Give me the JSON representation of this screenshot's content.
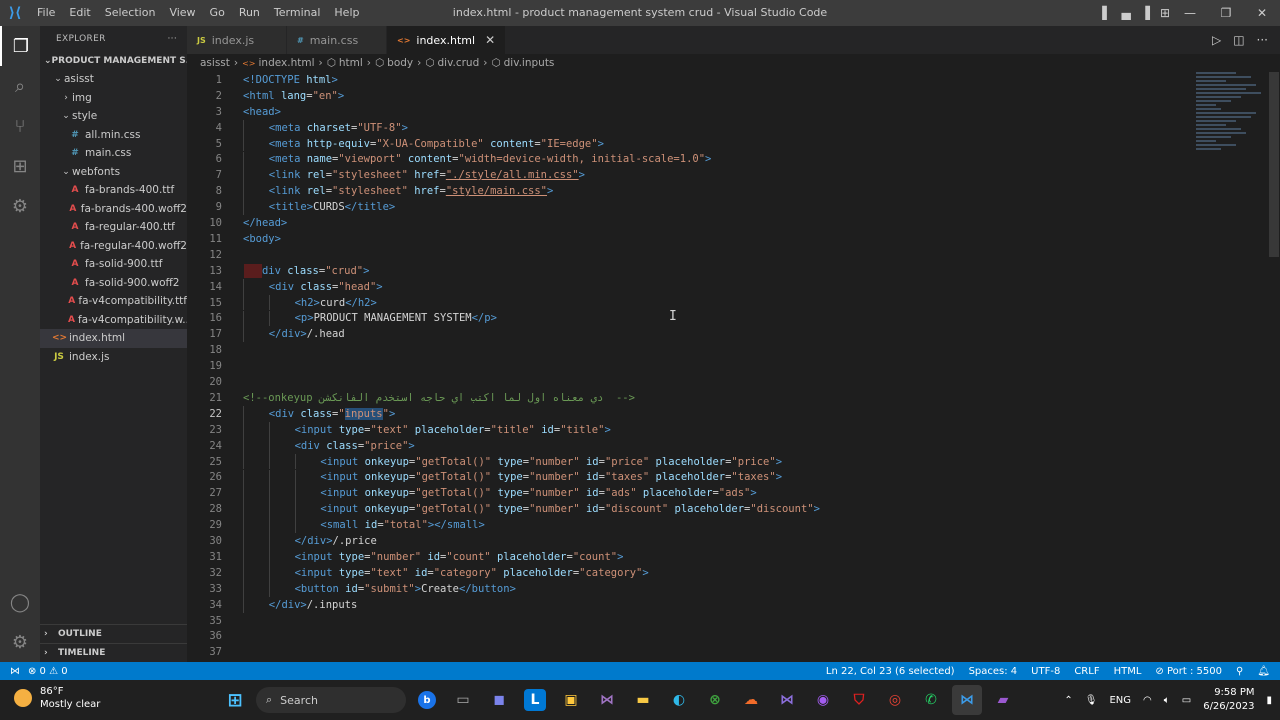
{
  "window": {
    "title": "index.html - product management system crud - Visual Studio Code",
    "menu": [
      "File",
      "Edit",
      "Selection",
      "View",
      "Go",
      "Run",
      "Terminal",
      "Help"
    ]
  },
  "sidebar": {
    "header": "EXPLORER",
    "project": "PRODUCT MANAGEMENT S...",
    "tree": [
      {
        "label": "asisst",
        "type": "folder-open",
        "depth": 1
      },
      {
        "label": "img",
        "type": "folder",
        "depth": 2
      },
      {
        "label": "style",
        "type": "folder-open",
        "depth": 2
      },
      {
        "label": "all.min.css",
        "type": "css",
        "depth": 3
      },
      {
        "label": "main.css",
        "type": "css",
        "depth": 3
      },
      {
        "label": "webfonts",
        "type": "folder-open",
        "depth": 2
      },
      {
        "label": "fa-brands-400.ttf",
        "type": "font",
        "depth": 3
      },
      {
        "label": "fa-brands-400.woff2",
        "type": "font",
        "depth": 3
      },
      {
        "label": "fa-regular-400.ttf",
        "type": "font",
        "depth": 3
      },
      {
        "label": "fa-regular-400.woff2",
        "type": "font",
        "depth": 3
      },
      {
        "label": "fa-solid-900.ttf",
        "type": "font",
        "depth": 3
      },
      {
        "label": "fa-solid-900.woff2",
        "type": "font",
        "depth": 3
      },
      {
        "label": "fa-v4compatibility.ttf",
        "type": "font",
        "depth": 3
      },
      {
        "label": "fa-v4compatibility.w...",
        "type": "font",
        "depth": 3
      },
      {
        "label": "index.html",
        "type": "html",
        "depth": 1,
        "selected": true
      },
      {
        "label": "index.js",
        "type": "js",
        "depth": 1
      }
    ],
    "outline": "OUTLINE",
    "timeline": "TIMELINE"
  },
  "tabs": [
    {
      "label": "index.js",
      "icon": "JS",
      "active": false
    },
    {
      "label": "main.css",
      "icon": "#",
      "active": false
    },
    {
      "label": "index.html",
      "icon": "<>",
      "active": true
    }
  ],
  "breadcrumb": [
    "asisst",
    "index.html",
    "html",
    "body",
    "div.crud",
    "div.inputs"
  ],
  "editor": {
    "current_line": 22,
    "lines": [
      {
        "n": 1,
        "indent": 0,
        "tokens": [
          [
            "tag",
            "<!DOCTYPE "
          ],
          [
            "attr",
            "html"
          ],
          [
            "tag",
            ">"
          ]
        ]
      },
      {
        "n": 2,
        "indent": 0,
        "tokens": [
          [
            "tag",
            "<html "
          ],
          [
            "attr",
            "lang"
          ],
          [
            "txt",
            "="
          ],
          [
            "str",
            "\"en\""
          ],
          [
            "tag",
            ">"
          ]
        ]
      },
      {
        "n": 3,
        "indent": 0,
        "tokens": [
          [
            "tag",
            "<head>"
          ]
        ]
      },
      {
        "n": 4,
        "indent": 1,
        "tokens": [
          [
            "tag",
            "<meta "
          ],
          [
            "attr",
            "charset"
          ],
          [
            "txt",
            "="
          ],
          [
            "str",
            "\"UTF-8\""
          ],
          [
            "tag",
            ">"
          ]
        ]
      },
      {
        "n": 5,
        "indent": 1,
        "tokens": [
          [
            "tag",
            "<meta "
          ],
          [
            "attr",
            "http-equiv"
          ],
          [
            "txt",
            "="
          ],
          [
            "str",
            "\"X-UA-Compatible\""
          ],
          [
            "txt",
            " "
          ],
          [
            "attr",
            "content"
          ],
          [
            "txt",
            "="
          ],
          [
            "str",
            "\"IE=edge\""
          ],
          [
            "tag",
            ">"
          ]
        ]
      },
      {
        "n": 6,
        "indent": 1,
        "tokens": [
          [
            "tag",
            "<meta "
          ],
          [
            "attr",
            "name"
          ],
          [
            "txt",
            "="
          ],
          [
            "str",
            "\"viewport\""
          ],
          [
            "txt",
            " "
          ],
          [
            "attr",
            "content"
          ],
          [
            "txt",
            "="
          ],
          [
            "str",
            "\"width=device-width, initial-scale=1.0\""
          ],
          [
            "tag",
            ">"
          ]
        ]
      },
      {
        "n": 7,
        "indent": 1,
        "tokens": [
          [
            "tag",
            "<link "
          ],
          [
            "attr",
            "rel"
          ],
          [
            "txt",
            "="
          ],
          [
            "str",
            "\"stylesheet\""
          ],
          [
            "txt",
            " "
          ],
          [
            "attr",
            "href"
          ],
          [
            "txt",
            "="
          ],
          [
            "str",
            "\"./style/all.min.css\""
          ],
          [
            "tag",
            ">"
          ]
        ]
      },
      {
        "n": 8,
        "indent": 1,
        "tokens": [
          [
            "tag",
            "<link "
          ],
          [
            "attr",
            "rel"
          ],
          [
            "txt",
            "="
          ],
          [
            "str",
            "\"stylesheet\""
          ],
          [
            "txt",
            " "
          ],
          [
            "attr",
            "href"
          ],
          [
            "txt",
            "="
          ],
          [
            "str",
            "\"style/main.css\""
          ],
          [
            "tag",
            ">"
          ]
        ]
      },
      {
        "n": 9,
        "indent": 1,
        "tokens": [
          [
            "tag",
            "<title>"
          ],
          [
            "txt",
            "CURDS"
          ],
          [
            "tag",
            "</title>"
          ]
        ]
      },
      {
        "n": 10,
        "indent": 0,
        "tokens": [
          [
            "tag",
            "</head>"
          ]
        ]
      },
      {
        "n": 11,
        "indent": 0,
        "tokens": [
          [
            "tag",
            "<body>"
          ]
        ]
      },
      {
        "n": 12,
        "indent": 0,
        "tokens": []
      },
      {
        "n": 13,
        "indent": 0,
        "tokens": [
          [
            "tag",
            "  <div "
          ],
          [
            "attr",
            "class"
          ],
          [
            "txt",
            "="
          ],
          [
            "str",
            "\"crud\""
          ],
          [
            "tag",
            ">"
          ]
        ]
      },
      {
        "n": 14,
        "indent": 1,
        "tokens": [
          [
            "tag",
            "<div "
          ],
          [
            "attr",
            "class"
          ],
          [
            "txt",
            "="
          ],
          [
            "str",
            "\"head\""
          ],
          [
            "tag",
            ">"
          ]
        ]
      },
      {
        "n": 15,
        "indent": 2,
        "tokens": [
          [
            "tag",
            "<h2>"
          ],
          [
            "txt",
            "curd"
          ],
          [
            "tag",
            "</h2>"
          ]
        ]
      },
      {
        "n": 16,
        "indent": 2,
        "tokens": [
          [
            "tag",
            "<p>"
          ],
          [
            "txt",
            "PRODUCT MANAGEMENT SYSTEM"
          ],
          [
            "tag",
            "</p>"
          ]
        ]
      },
      {
        "n": 17,
        "indent": 1,
        "tokens": [
          [
            "tag",
            "</div>"
          ],
          [
            "txt",
            "/.head"
          ]
        ]
      },
      {
        "n": 18,
        "indent": 0,
        "tokens": []
      },
      {
        "n": 19,
        "indent": 0,
        "tokens": []
      },
      {
        "n": 20,
        "indent": 0,
        "tokens": []
      },
      {
        "n": 21,
        "indent": 0,
        "tokens": [
          [
            "com",
            "<!--onkeyup دي معناه اول لما اكتب اي حاجه استخدم الفانكشن  -->"
          ]
        ]
      },
      {
        "n": 22,
        "indent": 1,
        "tokens": [
          [
            "tag",
            "<div "
          ],
          [
            "attr",
            "class"
          ],
          [
            "txt",
            "="
          ],
          [
            "str",
            "\""
          ],
          [
            "sel",
            "inputs"
          ],
          [
            "str",
            "\""
          ],
          [
            "tag",
            ">"
          ]
        ]
      },
      {
        "n": 23,
        "indent": 2,
        "tokens": [
          [
            "tag",
            "<input "
          ],
          [
            "attr",
            "type"
          ],
          [
            "txt",
            "="
          ],
          [
            "str",
            "\"text\""
          ],
          [
            "txt",
            " "
          ],
          [
            "attr",
            "placeholder"
          ],
          [
            "txt",
            "="
          ],
          [
            "str",
            "\"title\""
          ],
          [
            "txt",
            " "
          ],
          [
            "attr",
            "id"
          ],
          [
            "txt",
            "="
          ],
          [
            "str",
            "\"title\""
          ],
          [
            "tag",
            ">"
          ]
        ]
      },
      {
        "n": 24,
        "indent": 2,
        "tokens": [
          [
            "tag",
            "<div "
          ],
          [
            "attr",
            "class"
          ],
          [
            "txt",
            "="
          ],
          [
            "str",
            "\"price\""
          ],
          [
            "tag",
            ">"
          ]
        ]
      },
      {
        "n": 25,
        "indent": 3,
        "tokens": [
          [
            "tag",
            "<input "
          ],
          [
            "attr",
            "onkeyup"
          ],
          [
            "txt",
            "="
          ],
          [
            "str",
            "\"getTotal()\""
          ],
          [
            "txt",
            " "
          ],
          [
            "attr",
            "type"
          ],
          [
            "txt",
            "="
          ],
          [
            "str",
            "\"number\""
          ],
          [
            "txt",
            " "
          ],
          [
            "attr",
            "id"
          ],
          [
            "txt",
            "="
          ],
          [
            "str",
            "\"price\""
          ],
          [
            "txt",
            " "
          ],
          [
            "attr",
            "placeholder"
          ],
          [
            "txt",
            "="
          ],
          [
            "str",
            "\"price\""
          ],
          [
            "tag",
            ">"
          ]
        ]
      },
      {
        "n": 26,
        "indent": 3,
        "tokens": [
          [
            "tag",
            "<input "
          ],
          [
            "attr",
            "onkeyup"
          ],
          [
            "txt",
            "="
          ],
          [
            "str",
            "\"getTotal()\""
          ],
          [
            "txt",
            " "
          ],
          [
            "attr",
            "type"
          ],
          [
            "txt",
            "="
          ],
          [
            "str",
            "\"number\""
          ],
          [
            "txt",
            " "
          ],
          [
            "attr",
            "id"
          ],
          [
            "txt",
            "="
          ],
          [
            "str",
            "\"taxes\""
          ],
          [
            "txt",
            " "
          ],
          [
            "attr",
            "placeholder"
          ],
          [
            "txt",
            "="
          ],
          [
            "str",
            "\"taxes\""
          ],
          [
            "tag",
            ">"
          ]
        ]
      },
      {
        "n": 27,
        "indent": 3,
        "tokens": [
          [
            "tag",
            "<input "
          ],
          [
            "attr",
            "onkeyup"
          ],
          [
            "txt",
            "="
          ],
          [
            "str",
            "\"getTotal()\""
          ],
          [
            "txt",
            " "
          ],
          [
            "attr",
            "type"
          ],
          [
            "txt",
            "="
          ],
          [
            "str",
            "\"number\""
          ],
          [
            "txt",
            " "
          ],
          [
            "attr",
            "id"
          ],
          [
            "txt",
            "="
          ],
          [
            "str",
            "\"ads\""
          ],
          [
            "txt",
            " "
          ],
          [
            "attr",
            "placeholder"
          ],
          [
            "txt",
            "="
          ],
          [
            "str",
            "\"ads\""
          ],
          [
            "tag",
            ">"
          ]
        ]
      },
      {
        "n": 28,
        "indent": 3,
        "tokens": [
          [
            "tag",
            "<input "
          ],
          [
            "attr",
            "onkeyup"
          ],
          [
            "txt",
            "="
          ],
          [
            "str",
            "\"getTotal()\""
          ],
          [
            "txt",
            " "
          ],
          [
            "attr",
            "type"
          ],
          [
            "txt",
            "="
          ],
          [
            "str",
            "\"number\""
          ],
          [
            "txt",
            " "
          ],
          [
            "attr",
            "id"
          ],
          [
            "txt",
            "="
          ],
          [
            "str",
            "\"discount\""
          ],
          [
            "txt",
            " "
          ],
          [
            "attr",
            "placeholder"
          ],
          [
            "txt",
            "="
          ],
          [
            "str",
            "\"discount\""
          ],
          [
            "tag",
            ">"
          ]
        ]
      },
      {
        "n": 29,
        "indent": 3,
        "tokens": [
          [
            "tag",
            "<small "
          ],
          [
            "attr",
            "id"
          ],
          [
            "txt",
            "="
          ],
          [
            "str",
            "\"total\""
          ],
          [
            "tag",
            "></small>"
          ]
        ]
      },
      {
        "n": 30,
        "indent": 2,
        "tokens": [
          [
            "tag",
            "</div>"
          ],
          [
            "txt",
            "/.price"
          ]
        ]
      },
      {
        "n": 31,
        "indent": 2,
        "tokens": [
          [
            "tag",
            "<input "
          ],
          [
            "attr",
            "type"
          ],
          [
            "txt",
            "="
          ],
          [
            "str",
            "\"number\""
          ],
          [
            "txt",
            " "
          ],
          [
            "attr",
            "id"
          ],
          [
            "txt",
            "="
          ],
          [
            "str",
            "\"count\""
          ],
          [
            "txt",
            " "
          ],
          [
            "attr",
            "placeholder"
          ],
          [
            "txt",
            "="
          ],
          [
            "str",
            "\"count\""
          ],
          [
            "tag",
            ">"
          ]
        ]
      },
      {
        "n": 32,
        "indent": 2,
        "tokens": [
          [
            "tag",
            "<input "
          ],
          [
            "attr",
            "type"
          ],
          [
            "txt",
            "="
          ],
          [
            "str",
            "\"text\""
          ],
          [
            "txt",
            " "
          ],
          [
            "attr",
            "id"
          ],
          [
            "txt",
            "="
          ],
          [
            "str",
            "\"category\""
          ],
          [
            "txt",
            " "
          ],
          [
            "attr",
            "placeholder"
          ],
          [
            "txt",
            "="
          ],
          [
            "str",
            "\"category\""
          ],
          [
            "tag",
            ">"
          ]
        ]
      },
      {
        "n": 33,
        "indent": 2,
        "tokens": [
          [
            "tag",
            "<button "
          ],
          [
            "attr",
            "id"
          ],
          [
            "txt",
            "="
          ],
          [
            "str",
            "\"submit\""
          ],
          [
            "tag",
            ">"
          ],
          [
            "txt",
            "Create"
          ],
          [
            "tag",
            "</button>"
          ]
        ]
      },
      {
        "n": 34,
        "indent": 1,
        "tokens": [
          [
            "tag",
            "</div>"
          ],
          [
            "txt",
            "/.inputs"
          ]
        ]
      },
      {
        "n": 35,
        "indent": 0,
        "tokens": []
      },
      {
        "n": 36,
        "indent": 0,
        "tokens": []
      },
      {
        "n": 37,
        "indent": 0,
        "tokens": []
      }
    ]
  },
  "statusbar": {
    "problems": "⊗ 0 ⚠ 0",
    "position": "Ln 22, Col 23 (6 selected)",
    "spaces": "Spaces: 4",
    "encoding": "UTF-8",
    "eol": "CRLF",
    "language": "HTML",
    "port": "Port : 5500"
  },
  "taskbar": {
    "weather_temp": "86°F",
    "weather_desc": "Mostly clear",
    "search_placeholder": "Search",
    "language": "ENG",
    "time": "9:58 PM",
    "date": "6/26/2023"
  },
  "colors": {
    "statusbar": "#007acc",
    "editor_bg": "#1e1e1e",
    "tag": "#569cd6",
    "attr": "#9cdcfe",
    "string": "#ce9178",
    "comment": "#6a9955"
  }
}
